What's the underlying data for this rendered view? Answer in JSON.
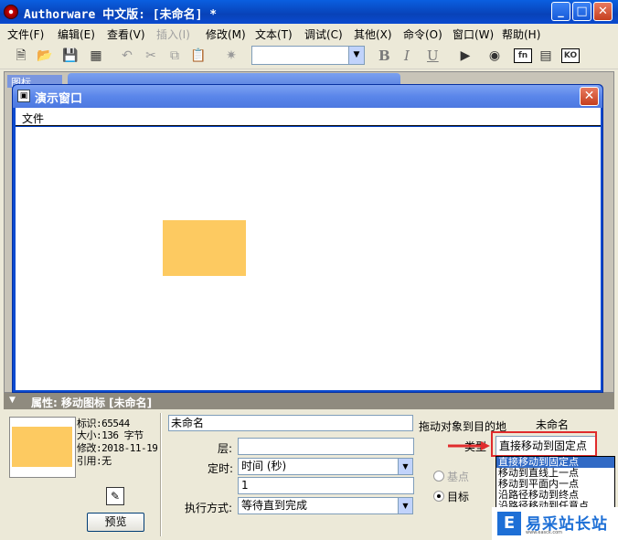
{
  "app": {
    "title": "Authorware 中文版: [未命名] *",
    "window_controls": {
      "minimize": "_",
      "maximize": "□",
      "close": "✕"
    }
  },
  "menubar": [
    {
      "label": "文件(F)",
      "disabled": false
    },
    {
      "label": "编辑(E)",
      "disabled": false
    },
    {
      "label": "查看(V)",
      "disabled": false
    },
    {
      "label": "插入(I)",
      "disabled": true
    },
    {
      "label": "修改(M)",
      "disabled": false
    },
    {
      "label": "文本(T)",
      "disabled": false
    },
    {
      "label": "调试(C)",
      "disabled": false
    },
    {
      "label": "其他(X)",
      "disabled": false
    },
    {
      "label": "命令(O)",
      "disabled": false
    },
    {
      "label": "窗口(W)",
      "disabled": false
    },
    {
      "label": "帮助(H)",
      "disabled": false
    }
  ],
  "toolbar": {
    "font_value": "",
    "bold": "B",
    "italic": "I",
    "underline": "U",
    "fn_label": "fn",
    "ko_label": "KO"
  },
  "background_window": {
    "title": "图标"
  },
  "presentation_window": {
    "title": "演示窗口",
    "menu_file": "文件",
    "shape_color": "#fdca61"
  },
  "properties": {
    "header": "属性: 移动图标 [未命名]",
    "info": {
      "id": "标识:65544",
      "size": "大小:136 字节",
      "modified": "修改:2018-11-19",
      "refs": "引用:无"
    },
    "preview_button": "预览",
    "name_value": "未命名",
    "layer_label": "层:",
    "layer_value": "",
    "timing_label": "定时:",
    "timing_value": "时间 (秒)",
    "timing_number": "1",
    "execution_label": "执行方式:",
    "execution_value": "等待直到完成",
    "drag_target_label": "拖动对象到目的地",
    "target_name": "未命名",
    "type_label": "类型",
    "type_value": "直接移动到固定点",
    "type_options": [
      "直接移动到固定点",
      "移动到直线上一点",
      "移动到平面内一点",
      "沿路径移动到终点",
      "沿路径移动到任意点"
    ],
    "radio_base": "基点",
    "radio_target": "目标"
  },
  "watermark": {
    "logo": "E",
    "text": "易采站长站",
    "sub": "www.easck.com"
  },
  "colors": {
    "title_bar": "#0842b8",
    "highlight": "#e02c2c",
    "selected_option": "#316ac5"
  }
}
